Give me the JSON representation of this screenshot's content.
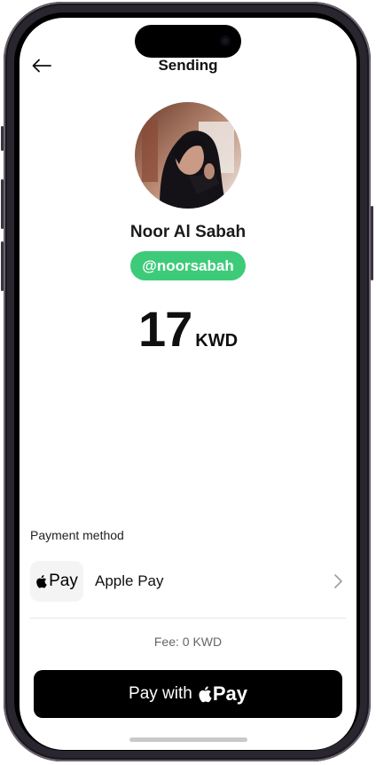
{
  "header": {
    "title": "Sending",
    "back_icon": "arrow-left-icon"
  },
  "recipient": {
    "name": "Noor Al Sabah",
    "handle": "@noorsabah"
  },
  "amount": {
    "value": "17",
    "currency": "KWD"
  },
  "payment": {
    "label": "Payment method",
    "method_logo_text": "Pay",
    "method_name": "Apple Pay",
    "chevron_icon": "chevron-right-icon"
  },
  "fee": "Fee: 0 KWD",
  "pay_button": {
    "prefix": "Pay with",
    "logo_text": "Pay"
  },
  "colors": {
    "accent": "#3ecb79",
    "button": "#000000"
  }
}
